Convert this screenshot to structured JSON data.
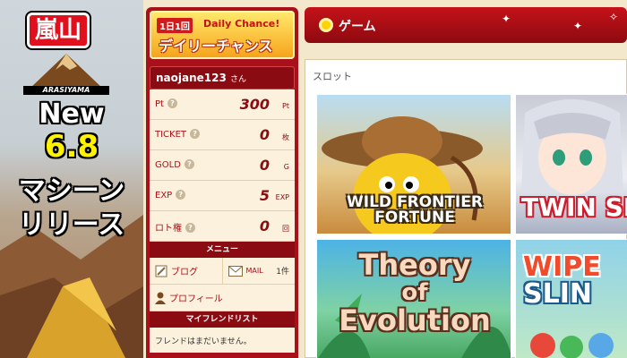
{
  "promo": {
    "logo_text": "嵐山",
    "brand": "ARASIYAMA",
    "line_new": "New",
    "line_version": "6.8",
    "line_machine": "マシーン",
    "line_release": "リリース"
  },
  "daily": {
    "badge": "1日1回",
    "english": "Daily Chance!",
    "japanese": "デイリーチャンス"
  },
  "user": {
    "name": "naojane123",
    "honorific": "さん"
  },
  "stats": [
    {
      "label": "Pt",
      "value": "300",
      "unit": "Pt"
    },
    {
      "label": "TICKET",
      "value": "0",
      "unit": "枚"
    },
    {
      "label": "GOLD",
      "value": "0",
      "unit": "G"
    },
    {
      "label": "EXP",
      "value": "5",
      "unit": "EXP"
    },
    {
      "label": "ロト権",
      "value": "0",
      "unit": "回"
    }
  ],
  "menu": {
    "section_title": "メニュー",
    "blog": "ブログ",
    "mail": "MAIL",
    "mail_count": "1件",
    "profile": "プロフィール"
  },
  "friends": {
    "section_title": "マイフレンドリスト",
    "empty_message": "フレンドはまだいません。"
  },
  "content": {
    "header_title": "ゲーム",
    "category": "スロット",
    "games": [
      {
        "title_line1": "WILD FRONTIER",
        "title_line2": "FORTUNE"
      },
      {
        "title": "TWIN SIS"
      },
      {
        "title_line1": "Theory",
        "title_line2": "of",
        "title_line3": "Evolution"
      },
      {
        "title_line1": "WIPE",
        "title_line2": "SLIN"
      }
    ]
  },
  "colors": {
    "panel_red": "#a8111a",
    "header_red": "#c51219",
    "cream": "#fbf1dc",
    "page_bg": "#f4e8cc"
  }
}
